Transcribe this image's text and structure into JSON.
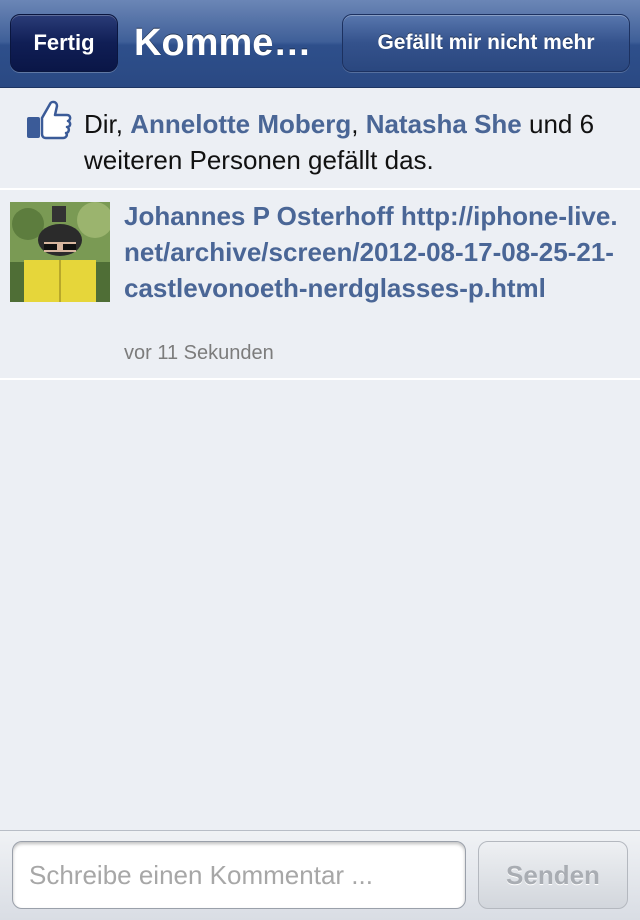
{
  "navbar": {
    "done_label": "Fertig",
    "title": "Komme…",
    "unlike_label": "Gefällt mir nicht mehr"
  },
  "likes": {
    "icon": "thumbs-up-icon",
    "prefix": "Dir, ",
    "name1": "Annelotte Moberg",
    "separator": ", ",
    "name2": "Natasha She",
    "suffix": " und 6 weiteren Personen gefällt das."
  },
  "comment": {
    "author": "Johannes P Osterhoff",
    "text": "http://iphone-live.net/archive/screen/2012-08-17-08-25-21-castlevonoeth-nerdglasses-p.html",
    "time": "vor 11 Sekunden"
  },
  "composer": {
    "placeholder": "Schreibe einen Kommentar ...",
    "send_label": "Senden"
  },
  "colors": {
    "navbar": "#3f5f98",
    "link": "#4a6696",
    "background": "#eceff4"
  }
}
